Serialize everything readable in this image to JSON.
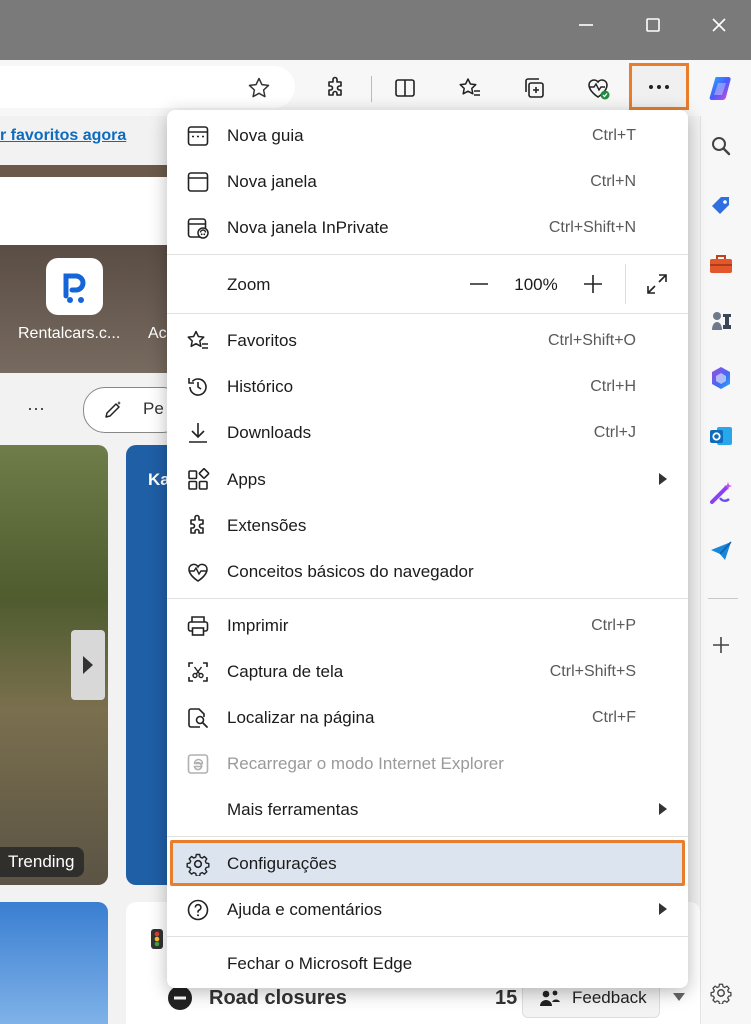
{
  "page": {
    "favorites_link": "r favoritos agora",
    "rental_label": "Rentalcars.c...",
    "ac_label": "Ac",
    "dots": "···",
    "personalize_label": "Pe",
    "ka_label": "Ka",
    "trending_label": "Trending",
    "road_closures_label": "Road closures",
    "road_closures_count": "15",
    "feedback_label": "Feedback"
  },
  "menu": {
    "new_tab": {
      "label": "Nova guia",
      "shortcut": "Ctrl+T"
    },
    "new_window": {
      "label": "Nova janela",
      "shortcut": "Ctrl+N"
    },
    "inprivate": {
      "label": "Nova janela InPrivate",
      "shortcut": "Ctrl+Shift+N"
    },
    "zoom": {
      "label": "Zoom",
      "value": "100%"
    },
    "favorites": {
      "label": "Favoritos",
      "shortcut": "Ctrl+Shift+O"
    },
    "history": {
      "label": "Histórico",
      "shortcut": "Ctrl+H"
    },
    "downloads": {
      "label": "Downloads",
      "shortcut": "Ctrl+J"
    },
    "apps": {
      "label": "Apps"
    },
    "extensions": {
      "label": "Extensões"
    },
    "essentials": {
      "label": "Conceitos básicos do navegador"
    },
    "print": {
      "label": "Imprimir",
      "shortcut": "Ctrl+P"
    },
    "screenshot": {
      "label": "Captura de tela",
      "shortcut": "Ctrl+Shift+S"
    },
    "find": {
      "label": "Localizar na página",
      "shortcut": "Ctrl+F"
    },
    "ie_mode": {
      "label": "Recarregar o modo Internet Explorer"
    },
    "more_tools": {
      "label": "Mais ferramentas"
    },
    "settings": {
      "label": "Configurações"
    },
    "help": {
      "label": "Ajuda e comentários"
    },
    "close": {
      "label": "Fechar o Microsoft Edge"
    }
  },
  "colors": {
    "highlight_border": "#e87d2b",
    "highlight_fill": "#dbe4ef",
    "link": "#0f6cbd"
  }
}
